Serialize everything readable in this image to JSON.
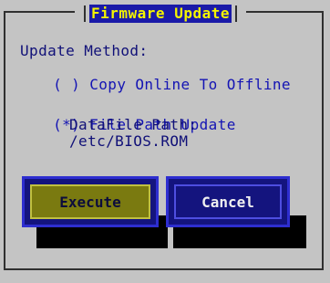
{
  "dialog": {
    "title": "Firmware Update",
    "method_label": "Update Method:",
    "options": [
      {
        "mark": "( )",
        "label": "Copy Online To Offline",
        "selected": false
      },
      {
        "mark": "(*)",
        "label": "File Path Update",
        "selected": true
      }
    ],
    "datafile_label": "DataFile Path:",
    "datafile_path": "/etc/BIOS.ROM"
  },
  "buttons": {
    "execute": "Execute",
    "cancel": "Cancel"
  },
  "colors": {
    "background": "#c4c4c4",
    "text": "#101078",
    "title_bg": "#1a1aa8",
    "title_fg": "#f4f400",
    "button_bg": "#14147e",
    "execute_focus": "#7a7a10"
  }
}
